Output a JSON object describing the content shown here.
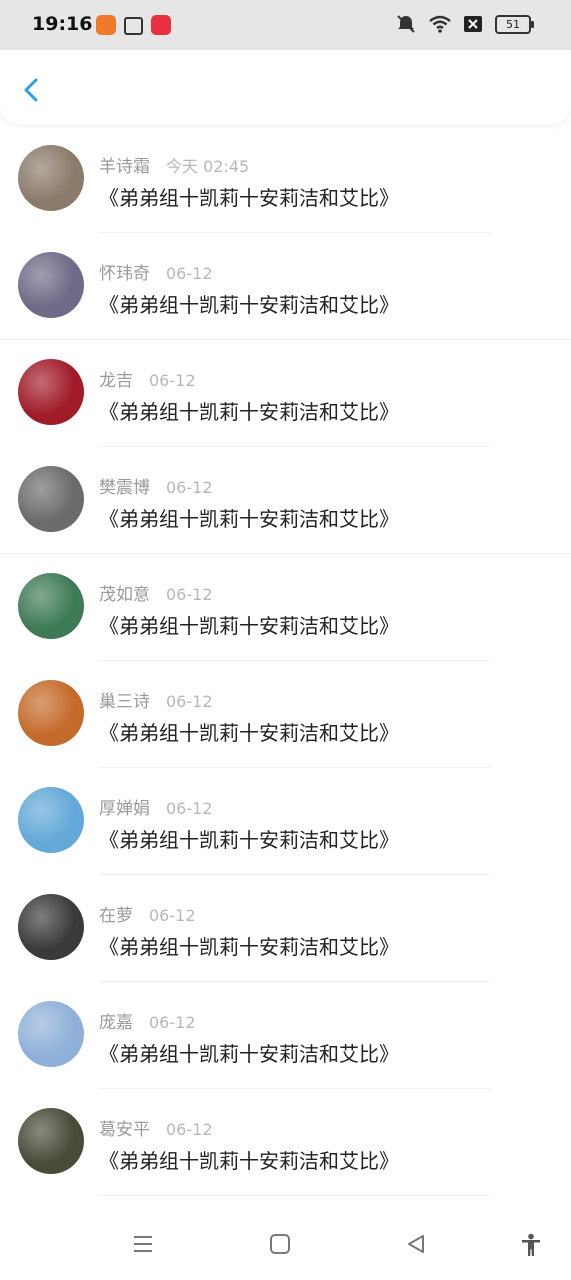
{
  "status_bar": {
    "time": "19:16",
    "battery_level": "51",
    "icons": [
      "mute-icon",
      "wifi-icon",
      "sim-icon",
      "battery-icon"
    ]
  },
  "header": {
    "back_icon": "chevron-left-icon",
    "accent": "#2aa1e2"
  },
  "list": {
    "items": [
      {
        "name": "羊诗霜",
        "time": "今天 02:45",
        "message": "《弟弟组十凯莉十安莉洁和艾比》",
        "avatar_color": "#8a7b6a"
      },
      {
        "name": "怀玮奇",
        "time": "06-12",
        "message": "《弟弟组十凯莉十安莉洁和艾比》",
        "avatar_color": "#6f6a86"
      },
      {
        "name": "龙吉",
        "time": "06-12",
        "message": "《弟弟组十凯莉十安莉洁和艾比》",
        "avatar_color": "#a01c2a"
      },
      {
        "name": "樊震博",
        "time": "06-12",
        "message": "《弟弟组十凯莉十安莉洁和艾比》",
        "avatar_color": "#6b6b6b"
      },
      {
        "name": "茂如意",
        "time": "06-12",
        "message": "《弟弟组十凯莉十安莉洁和艾比》",
        "avatar_color": "#3e7a56"
      },
      {
        "name": "巢三诗",
        "time": "06-12",
        "message": "《弟弟组十凯莉十安莉洁和艾比》",
        "avatar_color": "#c46a2a"
      },
      {
        "name": "厚婵娟",
        "time": "06-12",
        "message": "《弟弟组十凯莉十安莉洁和艾比》",
        "avatar_color": "#62a8d8"
      },
      {
        "name": "在萝",
        "time": "06-12",
        "message": "《弟弟组十凯莉十安莉洁和艾比》",
        "avatar_color": "#3a3a3a"
      },
      {
        "name": "庞嘉",
        "time": "06-12",
        "message": "《弟弟组十凯莉十安莉洁和艾比》",
        "avatar_color": "#8fb0d8"
      },
      {
        "name": "葛安平",
        "time": "06-12",
        "message": "《弟弟组十凯莉十安莉洁和艾比》",
        "avatar_color": "#4a4a3a"
      }
    ]
  },
  "navbar": {
    "icons": [
      "menu-icon",
      "home-icon",
      "back-triangle-icon",
      "accessibility-icon"
    ]
  }
}
